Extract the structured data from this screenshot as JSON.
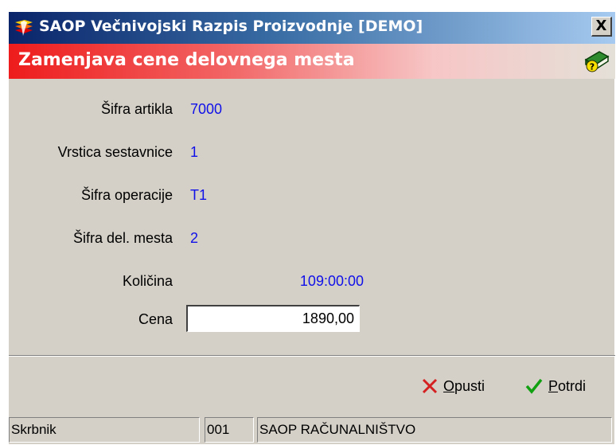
{
  "window": {
    "title": "SAOP  Večnivojski Razpis Proizvodnje [DEMO]",
    "close_label": "X"
  },
  "header": {
    "title": "Zamenjava cene delovnega mesta",
    "help_icon": "help-book-icon"
  },
  "form": {
    "sifra_artikla": {
      "label": "Šifra artikla",
      "value": "7000"
    },
    "vrstica_sestavnice": {
      "label": "Vrstica sestavnice",
      "value": "1"
    },
    "sifra_operacije": {
      "label": "Šifra operacije",
      "value": "T1"
    },
    "sifra_del_mesta": {
      "label": "Šifra del. mesta",
      "value": "2"
    },
    "kolicina": {
      "label": "Količina",
      "value": "109:00:00"
    },
    "cena": {
      "label": "Cena",
      "value": "1890,00"
    }
  },
  "buttons": {
    "cancel": {
      "first": "O",
      "rest": "pusti",
      "icon": "x-icon",
      "color": "#d42020"
    },
    "confirm": {
      "first": "P",
      "rest": "otrdi",
      "icon": "checkmark-icon",
      "color": "#10a010"
    }
  },
  "statusbar": {
    "user": "Skrbnik",
    "code": "001",
    "company": "SAOP RAČUNALNIŠTVO"
  },
  "colors": {
    "value_text": "#1010e8",
    "header_red": "#ee1c1c",
    "titlebar": "#0a246a"
  }
}
